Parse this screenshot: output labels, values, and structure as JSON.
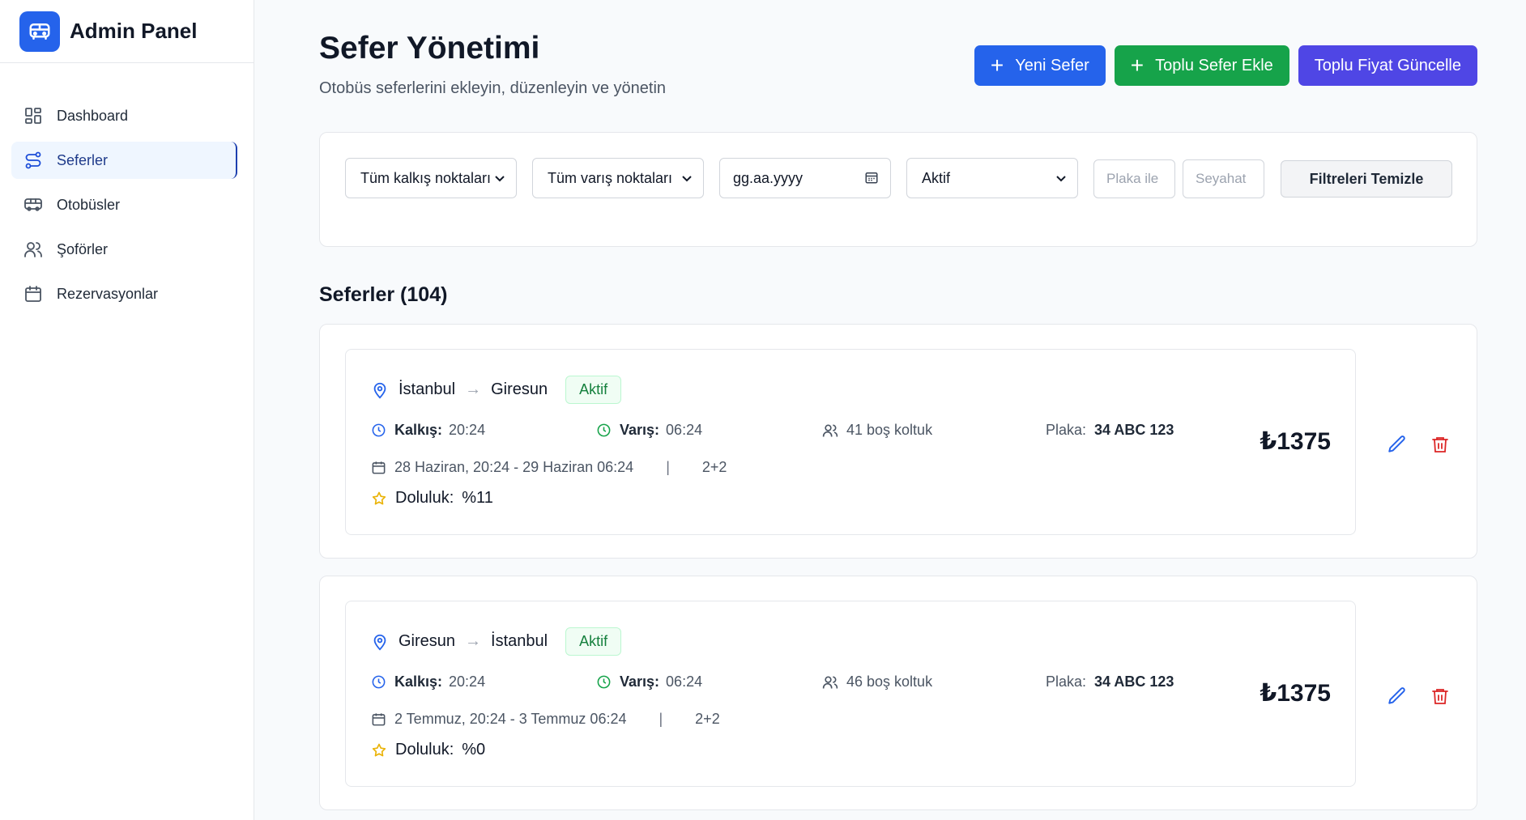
{
  "app": {
    "title": "Admin Panel",
    "logo_icon": "bus-icon"
  },
  "sidebar": {
    "items": [
      {
        "label": "Dashboard",
        "icon": "dashboard-icon",
        "active": false
      },
      {
        "label": "Seferler",
        "icon": "route-icon",
        "active": true
      },
      {
        "label": "Otobüsler",
        "icon": "bus-icon",
        "active": false
      },
      {
        "label": "Şoförler",
        "icon": "users-icon",
        "active": false
      },
      {
        "label": "Rezervasyonlar",
        "icon": "calendar-icon",
        "active": false
      }
    ]
  },
  "header": {
    "title": "Sefer Yönetimi",
    "subtitle": "Otobüs seferlerini ekleyin, düzenleyin ve yönetin"
  },
  "actions": {
    "new_trip": "Yeni Sefer",
    "bulk_add": "Toplu Sefer Ekle",
    "bulk_price": "Toplu Fiyat Güncelle"
  },
  "filters": {
    "departure": "Tüm kalkış noktaları",
    "arrival": "Tüm varış noktaları",
    "date_placeholder": "gg.aa.yyyy",
    "status": "Aktif",
    "plate_placeholder": "Plaka ile",
    "trip_placeholder": "Seyahat",
    "clear": "Filtreleri Temizle"
  },
  "list": {
    "title": "Seferler (104)"
  },
  "labels": {
    "departure": "Kalkış:",
    "arrival": "Varış:",
    "plate": "Plaka:",
    "occupancy": "Doluluk:"
  },
  "trips": [
    {
      "from": "İstanbul",
      "to": "Giresun",
      "status": "Aktif",
      "departure_time": "20:24",
      "arrival_time": "06:24",
      "seats": "41 boş koltuk",
      "plate": "34 ABC 123",
      "dates": "28 Haziran, 20:24 - 29 Haziran 06:24",
      "layout": "2+2",
      "occupancy": "%11",
      "price": "₺1375"
    },
    {
      "from": "Giresun",
      "to": "İstanbul",
      "status": "Aktif",
      "departure_time": "20:24",
      "arrival_time": "06:24",
      "seats": "46 boş koltuk",
      "plate": "34 ABC 123",
      "dates": "2 Temmuz, 20:24 - 3 Temmuz 06:24",
      "layout": "2+2",
      "occupancy": "%0",
      "price": "₺1375"
    }
  ],
  "colors": {
    "primary": "#2563eb",
    "success": "#16a34a",
    "indigo": "#4f46e5",
    "danger": "#dc2626",
    "star": "#eab308"
  }
}
